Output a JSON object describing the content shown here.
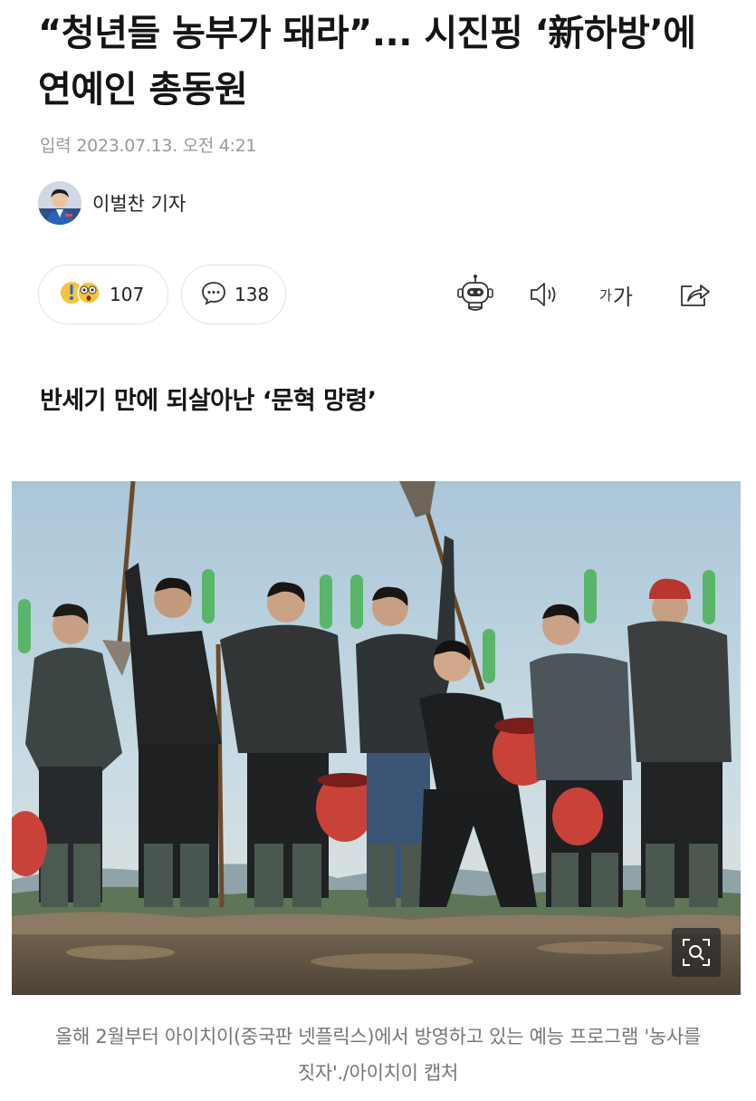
{
  "article": {
    "headline": "“청년들 농부가 돼라”... 시진핑 ‘新하방’에 연예인 총동원",
    "meta_label": "입력",
    "published": "2023.07.13. 오전 4:21",
    "author": "이벌찬 기자",
    "subheading": "반세기 만에 되살아난 ‘문혁 망령’",
    "caption": "올해 2월부터 아이치이(중국판 넷플릭스)에서 방영하고 있는 예능 프로그램 '농사를 짓자'./아이치이 캡처"
  },
  "reactions": {
    "count": "107",
    "icon": "surprised-emoji-icon"
  },
  "comments": {
    "count": "138",
    "icon": "speech-bubble-icon"
  },
  "toolbar": {
    "font_small": "가",
    "font_large": "가",
    "icons": [
      "robot-summary-icon",
      "speaker-icon",
      "font-size-icon",
      "share-icon"
    ]
  },
  "photo": {
    "description_icon": "zoom-icon"
  },
  "colors": {
    "text_primary": "#151515",
    "text_meta": "#9a9a9a",
    "caption": "#777777",
    "pill_border": "#e3e3e3"
  }
}
